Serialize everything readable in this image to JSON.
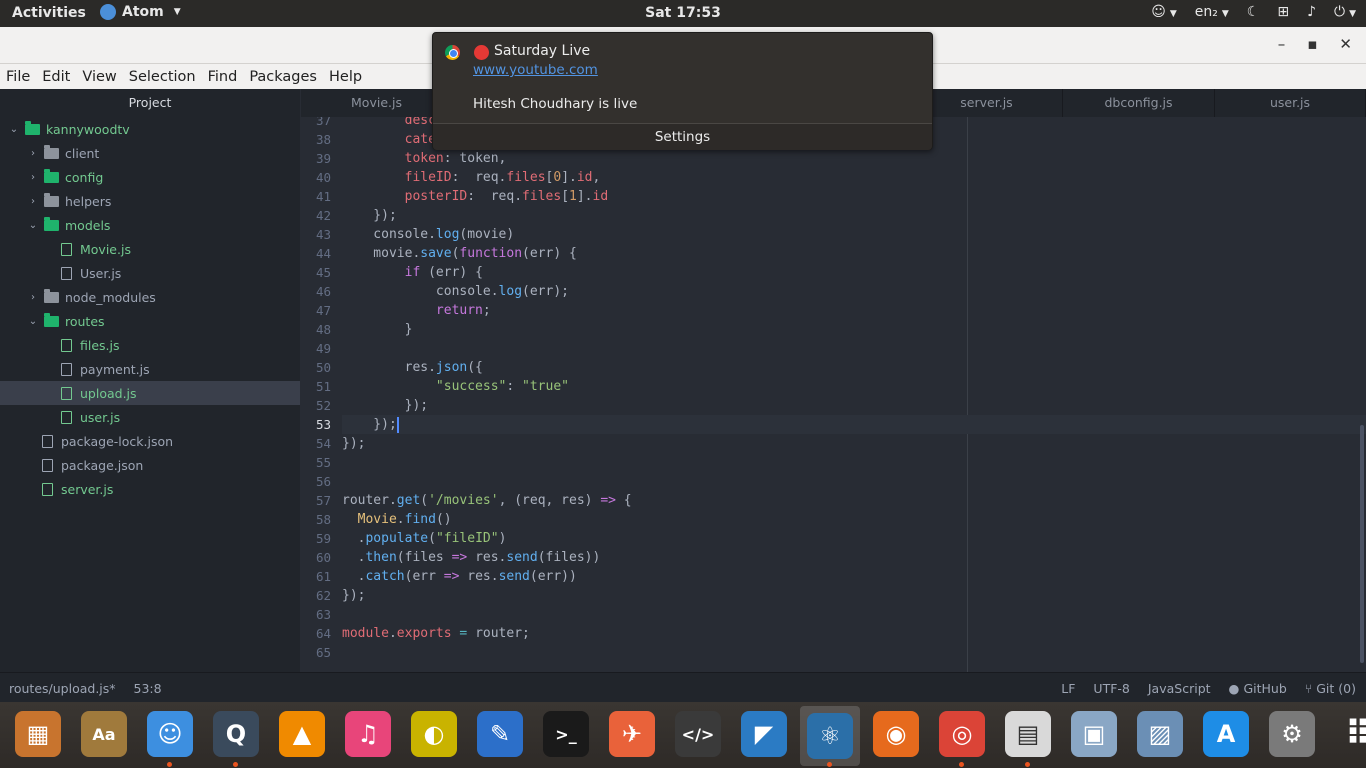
{
  "topbar": {
    "activities": "Activities",
    "app_name": "Atom",
    "clock": "Sat 17:53",
    "keyboard": "en₂",
    "icons": [
      "accessibility-icon",
      "night-light-icon",
      "network-icon",
      "volume-icon",
      "power-icon"
    ]
  },
  "window": {
    "buttons": [
      "minimize",
      "maximize",
      "close"
    ],
    "minimize_glyph": "–",
    "maximize_glyph": "▪",
    "close_glyph": "✕"
  },
  "menubar": [
    "File",
    "Edit",
    "View",
    "Selection",
    "Find",
    "Packages",
    "Help"
  ],
  "sidebar": {
    "title": "Project",
    "tree": [
      {
        "label": "kannywoodtv",
        "type": "folder",
        "expanded": true,
        "depth": 0,
        "color": "green"
      },
      {
        "label": "client",
        "type": "folder",
        "expanded": false,
        "depth": 1,
        "color": "gray"
      },
      {
        "label": "config",
        "type": "folder",
        "expanded": false,
        "depth": 1,
        "color": "green"
      },
      {
        "label": "helpers",
        "type": "folder",
        "expanded": false,
        "depth": 1,
        "color": "gray"
      },
      {
        "label": "models",
        "type": "folder",
        "expanded": true,
        "depth": 1,
        "color": "green"
      },
      {
        "label": "Movie.js",
        "type": "file",
        "depth": 2,
        "color": "green"
      },
      {
        "label": "User.js",
        "type": "file",
        "depth": 2,
        "color": "gray"
      },
      {
        "label": "node_modules",
        "type": "folder",
        "expanded": false,
        "depth": 1,
        "color": "gray"
      },
      {
        "label": "routes",
        "type": "folder",
        "expanded": true,
        "depth": 1,
        "color": "green"
      },
      {
        "label": "files.js",
        "type": "file",
        "depth": 2,
        "color": "green"
      },
      {
        "label": "payment.js",
        "type": "file",
        "depth": 2,
        "color": "gray"
      },
      {
        "label": "upload.js",
        "type": "file",
        "depth": 2,
        "color": "green",
        "selected": true
      },
      {
        "label": "user.js",
        "type": "file",
        "depth": 2,
        "color": "green"
      },
      {
        "label": "package-lock.json",
        "type": "file",
        "depth": 1,
        "color": "gray"
      },
      {
        "label": "package.json",
        "type": "file",
        "depth": 1,
        "color": "gray"
      },
      {
        "label": "server.js",
        "type": "file",
        "depth": 1,
        "color": "green"
      }
    ]
  },
  "tabs": [
    "Movie.js",
    "server.js",
    "dbconfig.js",
    "user.js"
  ],
  "editor": {
    "line_numbers": [
      "37",
      "38",
      "39",
      "40",
      "41",
      "42",
      "43",
      "44",
      "45",
      "46",
      "47",
      "48",
      "49",
      "50",
      "51",
      "52",
      "53",
      "54",
      "55",
      "56",
      "57",
      "58",
      "59",
      "60",
      "61",
      "62",
      "63",
      "64",
      "65"
    ],
    "current_line": "53"
  },
  "statusbar": {
    "file": "routes/upload.js*",
    "cursor": "53:8",
    "line_ending": "LF",
    "encoding": "UTF-8",
    "grammar": "JavaScript",
    "github": "GitHub",
    "git": "Git (0)"
  },
  "notification": {
    "title": "Saturday Live",
    "link": "www.youtube.com",
    "body": "Hitesh Choudhary is live",
    "settings": "Settings"
  },
  "dock": {
    "apps": [
      {
        "name": "calculator-icon",
        "color": "#c8742e",
        "running": false
      },
      {
        "name": "dictionary-icon",
        "color": "#a07a3c",
        "running": false,
        "glyph": "Aa"
      },
      {
        "name": "finder-icon",
        "color": "#3d8fe0",
        "running": true
      },
      {
        "name": "quicktime-icon",
        "color": "#3a4a5c",
        "running": true
      },
      {
        "name": "vlc-icon",
        "color": "#f08a00",
        "running": false
      },
      {
        "name": "itunes-icon",
        "color": "#e8457a",
        "running": false
      },
      {
        "name": "colorpicker-icon",
        "color": "#c9b300",
        "running": false
      },
      {
        "name": "texteditor-icon",
        "color": "#2c6fc9",
        "running": false
      },
      {
        "name": "terminal-icon",
        "color": "#1a1a1a",
        "running": false,
        "glyph": ">_"
      },
      {
        "name": "postman-icon",
        "color": "#e9623a",
        "running": false
      },
      {
        "name": "sublime-icon",
        "color": "#3a3a3a",
        "running": false,
        "glyph": "</>"
      },
      {
        "name": "vscode-icon",
        "color": "#2b7bc4",
        "running": false
      },
      {
        "name": "atom-icon",
        "color": "#2b6fa8",
        "running": true,
        "active": true
      },
      {
        "name": "firefox-icon",
        "color": "#e66a1d",
        "running": false
      },
      {
        "name": "chrome-icon",
        "color": "#db4437",
        "running": true
      },
      {
        "name": "notes-icon",
        "color": "#d9d9d9",
        "running": true
      },
      {
        "name": "preview-icon",
        "color": "#8aa7c5",
        "running": false
      },
      {
        "name": "image-viewer-icon",
        "color": "#6b8fb5",
        "running": false
      },
      {
        "name": "appstore-icon",
        "color": "#1e8de6",
        "running": false
      },
      {
        "name": "settings-icon",
        "color": "#7a7a7a",
        "running": false
      },
      {
        "name": "apps-grid-icon",
        "color": "transparent",
        "running": false
      }
    ]
  },
  "colors": {
    "accent_green": "#73c990",
    "folder_green": "#1fb36c",
    "link_blue": "#5294e2",
    "ubuntu_orange": "#e95420"
  }
}
